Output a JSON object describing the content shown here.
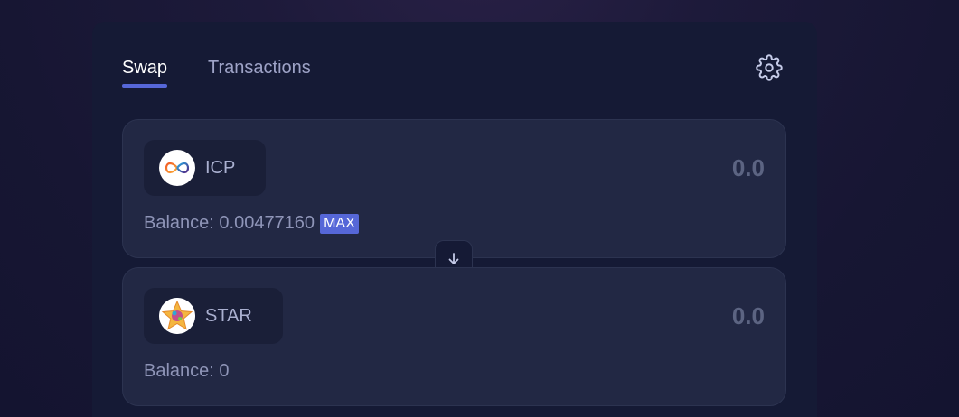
{
  "tabs": [
    {
      "label": "Swap",
      "active": true
    },
    {
      "label": "Transactions",
      "active": false
    }
  ],
  "settings": {
    "icon": "gear-icon"
  },
  "from_token": {
    "symbol": "ICP",
    "amount": "0.0",
    "balance_label": "Balance: 0.00477160",
    "max_label": "MAX",
    "icon": "icp-infinity-icon"
  },
  "to_token": {
    "symbol": "STAR",
    "amount": "0.0",
    "balance_label": "Balance: 0",
    "icon": "star-token-icon"
  },
  "swap_direction": {
    "icon": "arrow-down-icon"
  },
  "colors": {
    "accent": "#5667d8",
    "panel": "#151a35",
    "card": "#222844"
  }
}
